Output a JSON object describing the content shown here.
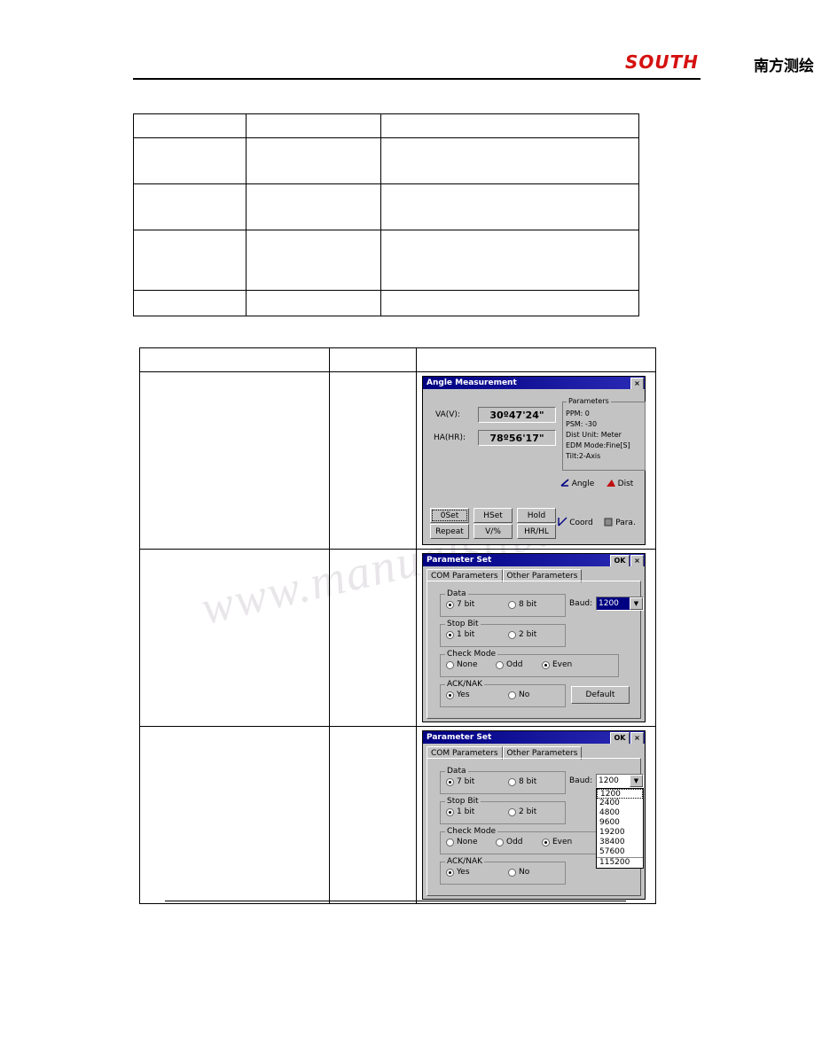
{
  "page": {
    "brand_latin": "SOUTH",
    "brand_cn": "南方测绘"
  },
  "table_one": {
    "rows": [
      {
        "c1": "",
        "c2": "",
        "c3": ""
      },
      {
        "c1": "",
        "c2": "",
        "c3": ""
      },
      {
        "c1": "",
        "c2": "",
        "c3": ""
      },
      {
        "c1": "",
        "c2": "",
        "c3": ""
      },
      {
        "c1": "",
        "c2": "",
        "c3": ""
      }
    ]
  },
  "table_two": {
    "rows": [
      {
        "c1": "",
        "c2": "",
        "c3": ""
      },
      {
        "c1": "",
        "c2": "",
        "c3": ""
      },
      {
        "c1": "",
        "c2": "",
        "c3": ""
      },
      {
        "c1": "",
        "c2": "",
        "c3": ""
      }
    ]
  },
  "watermark": {
    "text": "www.manualslib.com"
  },
  "angle_screen": {
    "title": "Angle Measurement",
    "close_label": "×",
    "va_label": "VA(V):",
    "va_value": "30º47'24\"",
    "ha_label": "HA(HR):",
    "ha_value": "78º56'17\"",
    "params": {
      "legend": "Parameters",
      "lines": [
        "PPM:  0",
        "PSM: -30",
        "Dist Unit: Meter",
        "EDM Mode:Fine[S]",
        "Tilt:2-Axis"
      ]
    },
    "softkeys": [
      "0Set",
      "HSet",
      "Hold",
      "Repeat",
      "V/%",
      "HR/HL"
    ],
    "right_keys": [
      {
        "label": "Angle",
        "icon": "angle-icon"
      },
      {
        "label": "Dist",
        "icon": "dist-icon"
      },
      {
        "label": "Coord",
        "icon": "coord-icon"
      },
      {
        "label": "Para.",
        "icon": "para-icon"
      }
    ]
  },
  "param_screen_a": {
    "title": "Parameter Set",
    "ok_label": "OK",
    "close_label": "×",
    "tabs": [
      {
        "label": "COM Parameters",
        "active": true
      },
      {
        "label": "Other Parameters",
        "active": false
      }
    ],
    "data_group": {
      "legend": "Data",
      "options": [
        {
          "label": "7 bit",
          "selected": true
        },
        {
          "label": "8 bit",
          "selected": false
        }
      ]
    },
    "stop_group": {
      "legend": "Stop Bit",
      "options": [
        {
          "label": "1 bit",
          "selected": true
        },
        {
          "label": "2 bit",
          "selected": false
        }
      ]
    },
    "check_group": {
      "legend": "Check Mode",
      "options": [
        {
          "label": "None",
          "selected": false
        },
        {
          "label": "Odd",
          "selected": false
        },
        {
          "label": "Even",
          "selected": true
        }
      ]
    },
    "ack_group": {
      "legend": "ACK/NAK",
      "options": [
        {
          "label": "Yes",
          "selected": true
        },
        {
          "label": "No",
          "selected": false
        }
      ]
    },
    "baud_label": "Baud:",
    "baud_value": "1200",
    "baud_highlighted": true,
    "default_button": "Default"
  },
  "param_screen_b": {
    "title": "Parameter Set",
    "ok_label": "OK",
    "close_label": "×",
    "tabs": [
      {
        "label": "COM Parameters",
        "active": true
      },
      {
        "label": "Other Parameters",
        "active": false
      }
    ],
    "data_group": {
      "legend": "Data",
      "options": [
        {
          "label": "7 bit",
          "selected": true
        },
        {
          "label": "8 bit",
          "selected": false
        }
      ]
    },
    "stop_group": {
      "legend": "Stop Bit",
      "options": [
        {
          "label": "1 bit",
          "selected": true
        },
        {
          "label": "2 bit",
          "selected": false
        }
      ]
    },
    "check_group": {
      "legend": "Check Mode",
      "options": [
        {
          "label": "None",
          "selected": false
        },
        {
          "label": "Odd",
          "selected": false
        },
        {
          "label": "Even",
          "selected": true
        }
      ]
    },
    "ack_group": {
      "legend": "ACK/NAK",
      "options": [
        {
          "label": "Yes",
          "selected": true
        },
        {
          "label": "No",
          "selected": false
        }
      ]
    },
    "baud_label": "Baud:",
    "baud_value": "1200",
    "baud_options": [
      "1200",
      "2400",
      "4800",
      "9600",
      "19200",
      "38400",
      "57600",
      "115200"
    ]
  }
}
